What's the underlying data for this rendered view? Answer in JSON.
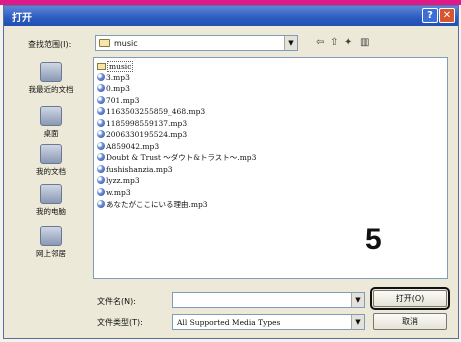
{
  "window": {
    "title": "打开",
    "help_glyph": "?",
    "close_glyph": "✕"
  },
  "look_in": {
    "label": "查找范围(I):",
    "value": "music"
  },
  "toolbar": {
    "back": "⇦",
    "up": "⇧",
    "new_folder": "✦",
    "view": "▥"
  },
  "places": [
    {
      "label": "我最近的文档",
      "icon": "recent-documents-icon"
    },
    {
      "label": "桌面",
      "icon": "desktop-icon"
    },
    {
      "label": "我的文档",
      "icon": "my-documents-icon"
    },
    {
      "label": "我的电脑",
      "icon": "my-computer-icon"
    },
    {
      "label": "网上邻居",
      "icon": "network-places-icon"
    }
  ],
  "files": [
    {
      "name": "music",
      "kind": "folder"
    },
    {
      "name": "3.mp3",
      "kind": "audio"
    },
    {
      "name": "0.mp3",
      "kind": "audio"
    },
    {
      "name": "701.mp3",
      "kind": "audio"
    },
    {
      "name": "1163503255859_468.mp3",
      "kind": "audio"
    },
    {
      "name": "1185998559137.mp3",
      "kind": "audio"
    },
    {
      "name": "2006330195524.mp3",
      "kind": "audio"
    },
    {
      "name": "A859042.mp3",
      "kind": "audio"
    },
    {
      "name": "Doubt & Trust ～ダウト&トラスト～.mp3",
      "kind": "audio"
    },
    {
      "name": "fushishanzia.mp3",
      "kind": "audio"
    },
    {
      "name": "lyzz.mp3",
      "kind": "audio"
    },
    {
      "name": "w.mp3",
      "kind": "audio"
    },
    {
      "name": "あなたがここにいる理由.mp3",
      "kind": "audio"
    }
  ],
  "annotation": "5",
  "file_name": {
    "label": "文件名(N):",
    "value": ""
  },
  "file_type": {
    "label": "文件类型(T):",
    "value": "All Supported Media Types"
  },
  "buttons": {
    "open": "打开(O)",
    "cancel": "取消"
  },
  "colors": {
    "title_bar": "#2c5bc0",
    "close_button": "#d9552e",
    "accent_strip": "#e0198a"
  }
}
